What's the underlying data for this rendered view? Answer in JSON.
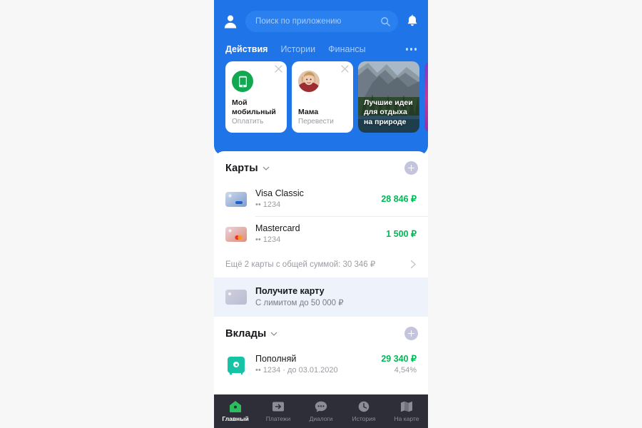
{
  "header": {
    "profile_icon": "person-icon",
    "search": {
      "placeholder": "Поиск по приложению",
      "icon": "search-icon"
    },
    "notifications_icon": "bell-icon",
    "accent_blue": "#1f74e8",
    "tabs": [
      {
        "label": "Действия",
        "active": true
      },
      {
        "label": "Истории",
        "active": false
      },
      {
        "label": "Финансы",
        "active": false
      }
    ],
    "more_icon": "ellipsis-icon"
  },
  "stories": [
    {
      "badge": "phone-icon",
      "title": "Мой мобильный",
      "subtitle": "Оплатить",
      "close_icon": "close-icon",
      "type": "action"
    },
    {
      "badge": "avatar",
      "title": "Мама",
      "subtitle": "Перевести",
      "close_icon": "close-icon",
      "type": "action"
    },
    {
      "title": "Лучшие идеи для отдыха на природе",
      "type": "photo"
    },
    {
      "title": "",
      "type": "partial"
    }
  ],
  "cards_section": {
    "title": "Карты",
    "caret_icon": "chevron-down-icon",
    "add_icon": "plus-icon",
    "rows": [
      {
        "icon": "visa-card-icon",
        "title": "Visa Classic",
        "subtitle": "•• 1234",
        "amount": "28 846 ₽"
      },
      {
        "icon": "mastercard-card-icon",
        "title": "Mastercard",
        "subtitle": "•• 1234",
        "amount": "1 500 ₽"
      }
    ],
    "more_row": {
      "text": "Ещё 2 карты с общей суммой: 30 346 ₽",
      "chevron_icon": "chevron-right-icon"
    }
  },
  "promo": {
    "icon": "grey-card-icon",
    "title": "Получите карту",
    "subtitle": "С лимитом до 50 000 ₽",
    "background": "#eef2fb"
  },
  "deposits_section": {
    "title": "Вклады",
    "caret_icon": "chevron-down-icon",
    "add_icon": "plus-icon",
    "rows": [
      {
        "icon": "safe-icon",
        "title": "Пополняй",
        "subtitle": "•• 1234 · до 03.01.2020",
        "amount": "29 340 ₽",
        "rate": "4,54%"
      }
    ]
  },
  "bottom_nav": {
    "background": "#2e2e38",
    "items": [
      {
        "label": "Главный",
        "icon": "home-icon",
        "active": true
      },
      {
        "label": "Платежи",
        "icon": "arrow-right-box-icon",
        "active": false
      },
      {
        "label": "Диалоги",
        "icon": "chat-bubble-icon",
        "active": false
      },
      {
        "label": "История",
        "icon": "clock-icon",
        "active": false
      },
      {
        "label": "На карте",
        "icon": "map-icon",
        "active": false
      }
    ]
  },
  "colors": {
    "amount_green": "#00b956",
    "header_blue": "#1f74e8",
    "nav_dark": "#2e2e38",
    "promo_bg": "#eef2fb"
  }
}
